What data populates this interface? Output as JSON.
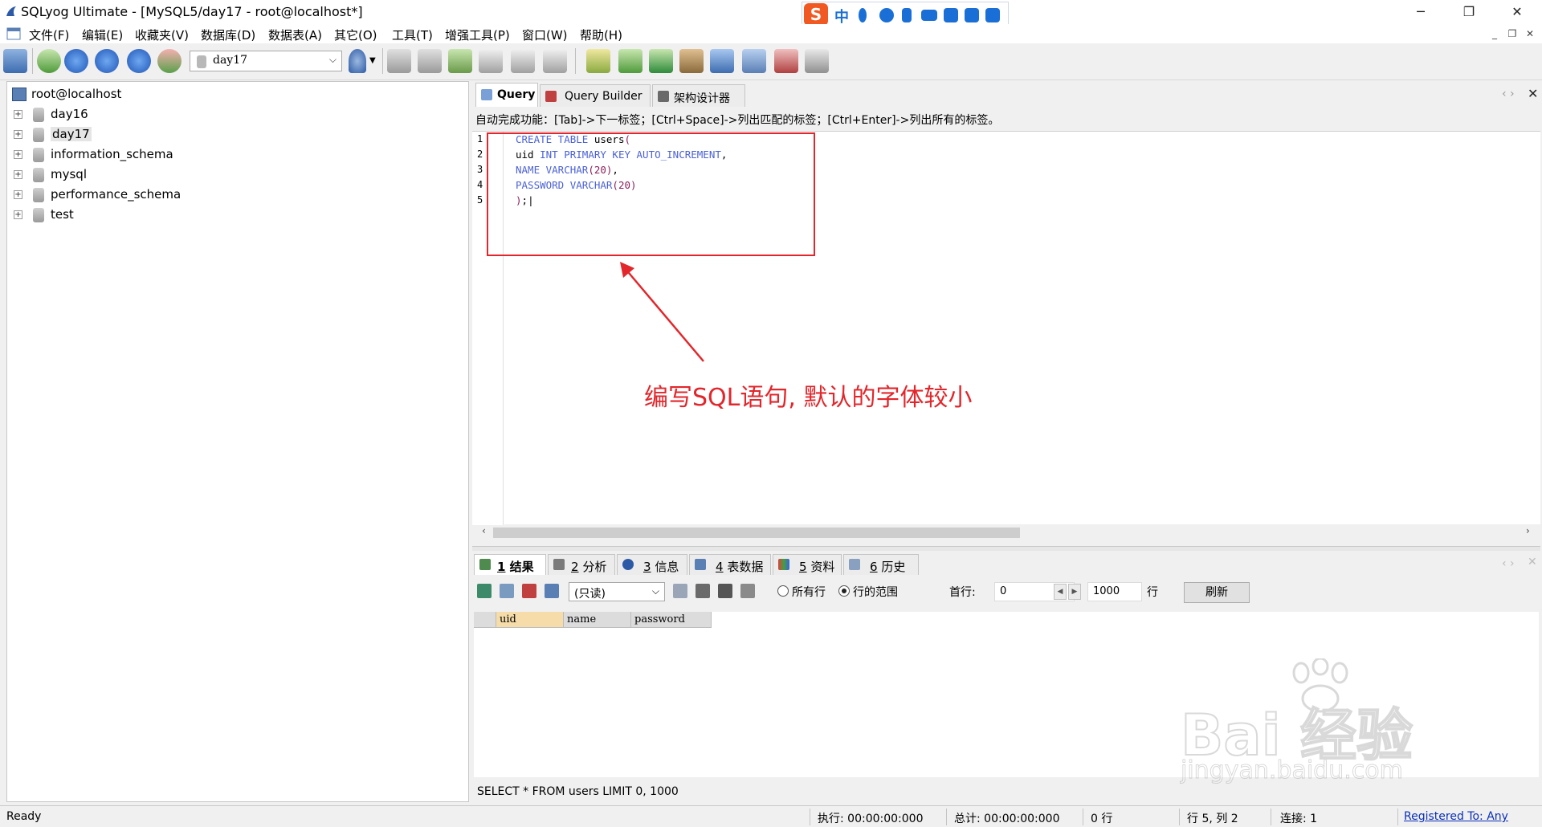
{
  "window": {
    "title": "SQLyog Ultimate - [MySQL5/day17 - root@localhost*]",
    "minimize": "─",
    "restore": "❐",
    "close": "✕"
  },
  "ime": {
    "logo": "S",
    "lang": "中"
  },
  "menu": [
    "文件(F)",
    "编辑(E)",
    "收藏夹(V)",
    "数据库(D)",
    "数据表(A)",
    "其它(O)",
    "工具(T)",
    "增强工具(P)",
    "窗口(W)",
    "帮助(H)"
  ],
  "toolbar": {
    "database_select": "day17"
  },
  "tree": {
    "root": "root@localhost",
    "databases": [
      "day16",
      "day17",
      "information_schema",
      "mysql",
      "performance_schema",
      "test"
    ],
    "selected": "day17"
  },
  "editor": {
    "tabs": [
      "Query",
      "Query Builder",
      "架构设计器"
    ],
    "autocomplete_hint": "自动完成功能：[Tab]->下一标签；[Ctrl+Space]->列出匹配的标签；[Ctrl+Enter]->列出所有的标签。",
    "line_numbers": [
      "1",
      "2",
      "3",
      "4",
      "5"
    ],
    "code": [
      [
        {
          "t": "CREATE TABLE ",
          "c": "kw"
        },
        {
          "t": "users",
          "c": "id"
        },
        {
          "t": "(",
          "c": "par"
        }
      ],
      [
        {
          "t": "uid ",
          "c": "id"
        },
        {
          "t": "INT PRIMARY KEY AUTO_INCREMENT",
          "c": "kw"
        },
        {
          "t": ",",
          "c": "id"
        }
      ],
      [
        {
          "t": "NAME VARCHAR",
          "c": "kw"
        },
        {
          "t": "(20)",
          "c": "par"
        },
        {
          "t": ",",
          "c": "id"
        }
      ],
      [
        {
          "t": "PASSWORD VARCHAR",
          "c": "kw"
        },
        {
          "t": "(20)",
          "c": "par"
        }
      ],
      [
        {
          "t": ")",
          "c": "par"
        },
        {
          "t": ";",
          "c": "id"
        },
        {
          "t": "|",
          "c": "id"
        }
      ]
    ]
  },
  "annotation": {
    "text": "编写SQL语句, 默认的字体较小",
    "color": "#e3262b"
  },
  "results": {
    "tabs": [
      {
        "num": "1",
        "label": "结果"
      },
      {
        "num": "2",
        "label": "分析"
      },
      {
        "num": "3",
        "label": "信息"
      },
      {
        "num": "4",
        "label": "表数据"
      },
      {
        "num": "5",
        "label": "资料"
      },
      {
        "num": "6",
        "label": "历史"
      }
    ],
    "mode_select": "(只读)",
    "all_rows_label": "所有行",
    "row_range_label": "行的范围",
    "first_row_label": "首行:",
    "first_row_value": "0",
    "row_count_value": "1000",
    "rows_unit": "行",
    "refresh_label": "刷新",
    "columns": [
      "uid",
      "name",
      "password"
    ],
    "sql": "SELECT * FROM users LIMIT 0, 1000"
  },
  "watermark": {
    "line1": "Bai 经验",
    "line2": "jingyan.baidu.com"
  },
  "status": {
    "ready": "Ready",
    "exec": "执行: 00:00:00:000",
    "total": "总计: 00:00:00:000",
    "rows": "0 行",
    "position": "行 5, 列 2",
    "connections": "连接: 1",
    "registered": "Registered To: Any"
  },
  "colors": {
    "accent_red": "#e3262b",
    "keyword": "#4b62d6",
    "paren": "#8a1f5a"
  }
}
